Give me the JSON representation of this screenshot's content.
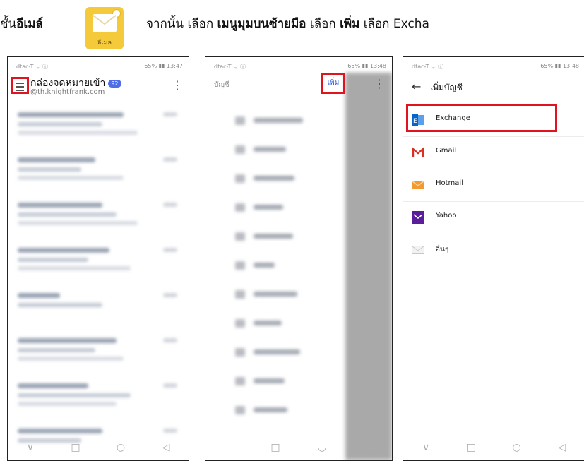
{
  "instruction": {
    "part1_prefix": "ชั้น",
    "part1_bold": "อีเมล์",
    "app_icon_label": "อีเมล",
    "part2": [
      {
        "text": "จากนั้น เลือก ",
        "bold": false
      },
      {
        "text": "เมนูมุมบนซ้ายมือ",
        "bold": true
      },
      {
        "text": " เลือก ",
        "bold": false
      },
      {
        "text": "เพิ่ม",
        "bold": true
      },
      {
        "text": " เลือก Excha",
        "bold": false
      }
    ],
    "accent_color": "#e0141e"
  },
  "phone1": {
    "status_left": "dtac-T ᯤ ⓘ",
    "status_right": "65% ▮▮ 13:47",
    "title": "กล่องจดหมายเข้า",
    "badge": "92",
    "account": "@th.knightfrank.com",
    "kebab": "⋮",
    "nav": [
      "∨",
      "□",
      "○",
      "◁"
    ]
  },
  "phone2": {
    "status_left": "dtac-T ᯤ ⓘ",
    "status_right": "65% ▮▮ 13:48",
    "header_label": "บัญชี",
    "add_button": "เพิ่ม",
    "kebab": "⋮",
    "nav": [
      "",
      "□",
      "◡",
      "◁"
    ]
  },
  "phone3": {
    "status_left": "dtac-T ᯤ ⓘ",
    "status_right": "65% ▮▮ 13:48",
    "back": "←",
    "title": "เพิ่มบัญชี",
    "options": [
      {
        "label": "Exchange",
        "icon": "exchange-icon"
      },
      {
        "label": "Gmail",
        "icon": "gmail-icon"
      },
      {
        "label": "Hotmail",
        "icon": "hotmail-icon"
      },
      {
        "label": "Yahoo",
        "icon": "yahoo-icon"
      },
      {
        "label": "อื่นๆ",
        "icon": "mail-icon"
      }
    ],
    "nav": [
      "∨",
      "□",
      "○",
      "◁"
    ]
  }
}
